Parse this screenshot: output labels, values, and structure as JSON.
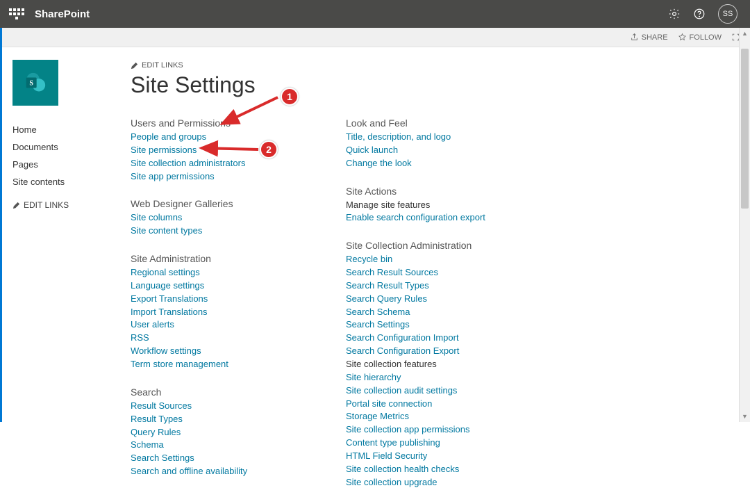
{
  "header": {
    "brand": "SharePoint",
    "avatar": "SS"
  },
  "ribbon": {
    "share": "SHARE",
    "follow": "FOLLOW"
  },
  "nav": {
    "items": [
      "Home",
      "Documents",
      "Pages",
      "Site contents"
    ],
    "edit_links": "EDIT LINKS"
  },
  "main": {
    "edit_links": "EDIT LINKS",
    "page_title": "Site Settings"
  },
  "col1": {
    "g0": {
      "heading": "Users and Permissions",
      "links": [
        "People and groups",
        "Site permissions",
        "Site collection administrators",
        "Site app permissions"
      ]
    },
    "g1": {
      "heading": "Web Designer Galleries",
      "links": [
        "Site columns",
        "Site content types"
      ]
    },
    "g2": {
      "heading": "Site Administration",
      "links": [
        "Regional settings",
        "Language settings",
        "Export Translations",
        "Import Translations",
        "User alerts",
        "RSS",
        "Workflow settings",
        "Term store management"
      ]
    },
    "g3": {
      "heading": "Search",
      "links": [
        "Result Sources",
        "Result Types",
        "Query Rules",
        "Schema",
        "Search Settings",
        "Search and offline availability"
      ]
    }
  },
  "col2": {
    "g0": {
      "heading": "Look and Feel",
      "links": [
        "Title, description, and logo",
        "Quick launch",
        "Change the look"
      ]
    },
    "g1": {
      "heading": "Site Actions",
      "static": "Manage site features",
      "links": [
        "Enable search configuration export"
      ]
    },
    "g2": {
      "heading": "Site Collection Administration",
      "links": [
        "Recycle bin",
        "Search Result Sources",
        "Search Result Types",
        "Search Query Rules",
        "Search Schema",
        "Search Settings",
        "Search Configuration Import",
        "Search Configuration Export"
      ],
      "static": "Site collection features",
      "links2": [
        "Site hierarchy",
        "Site collection audit settings",
        "Portal site connection",
        "Storage Metrics",
        "Site collection app permissions",
        "Content type publishing",
        "HTML Field Security",
        "Site collection health checks",
        "Site collection upgrade"
      ]
    }
  },
  "annotations": {
    "badge1": "1",
    "badge2": "2"
  }
}
